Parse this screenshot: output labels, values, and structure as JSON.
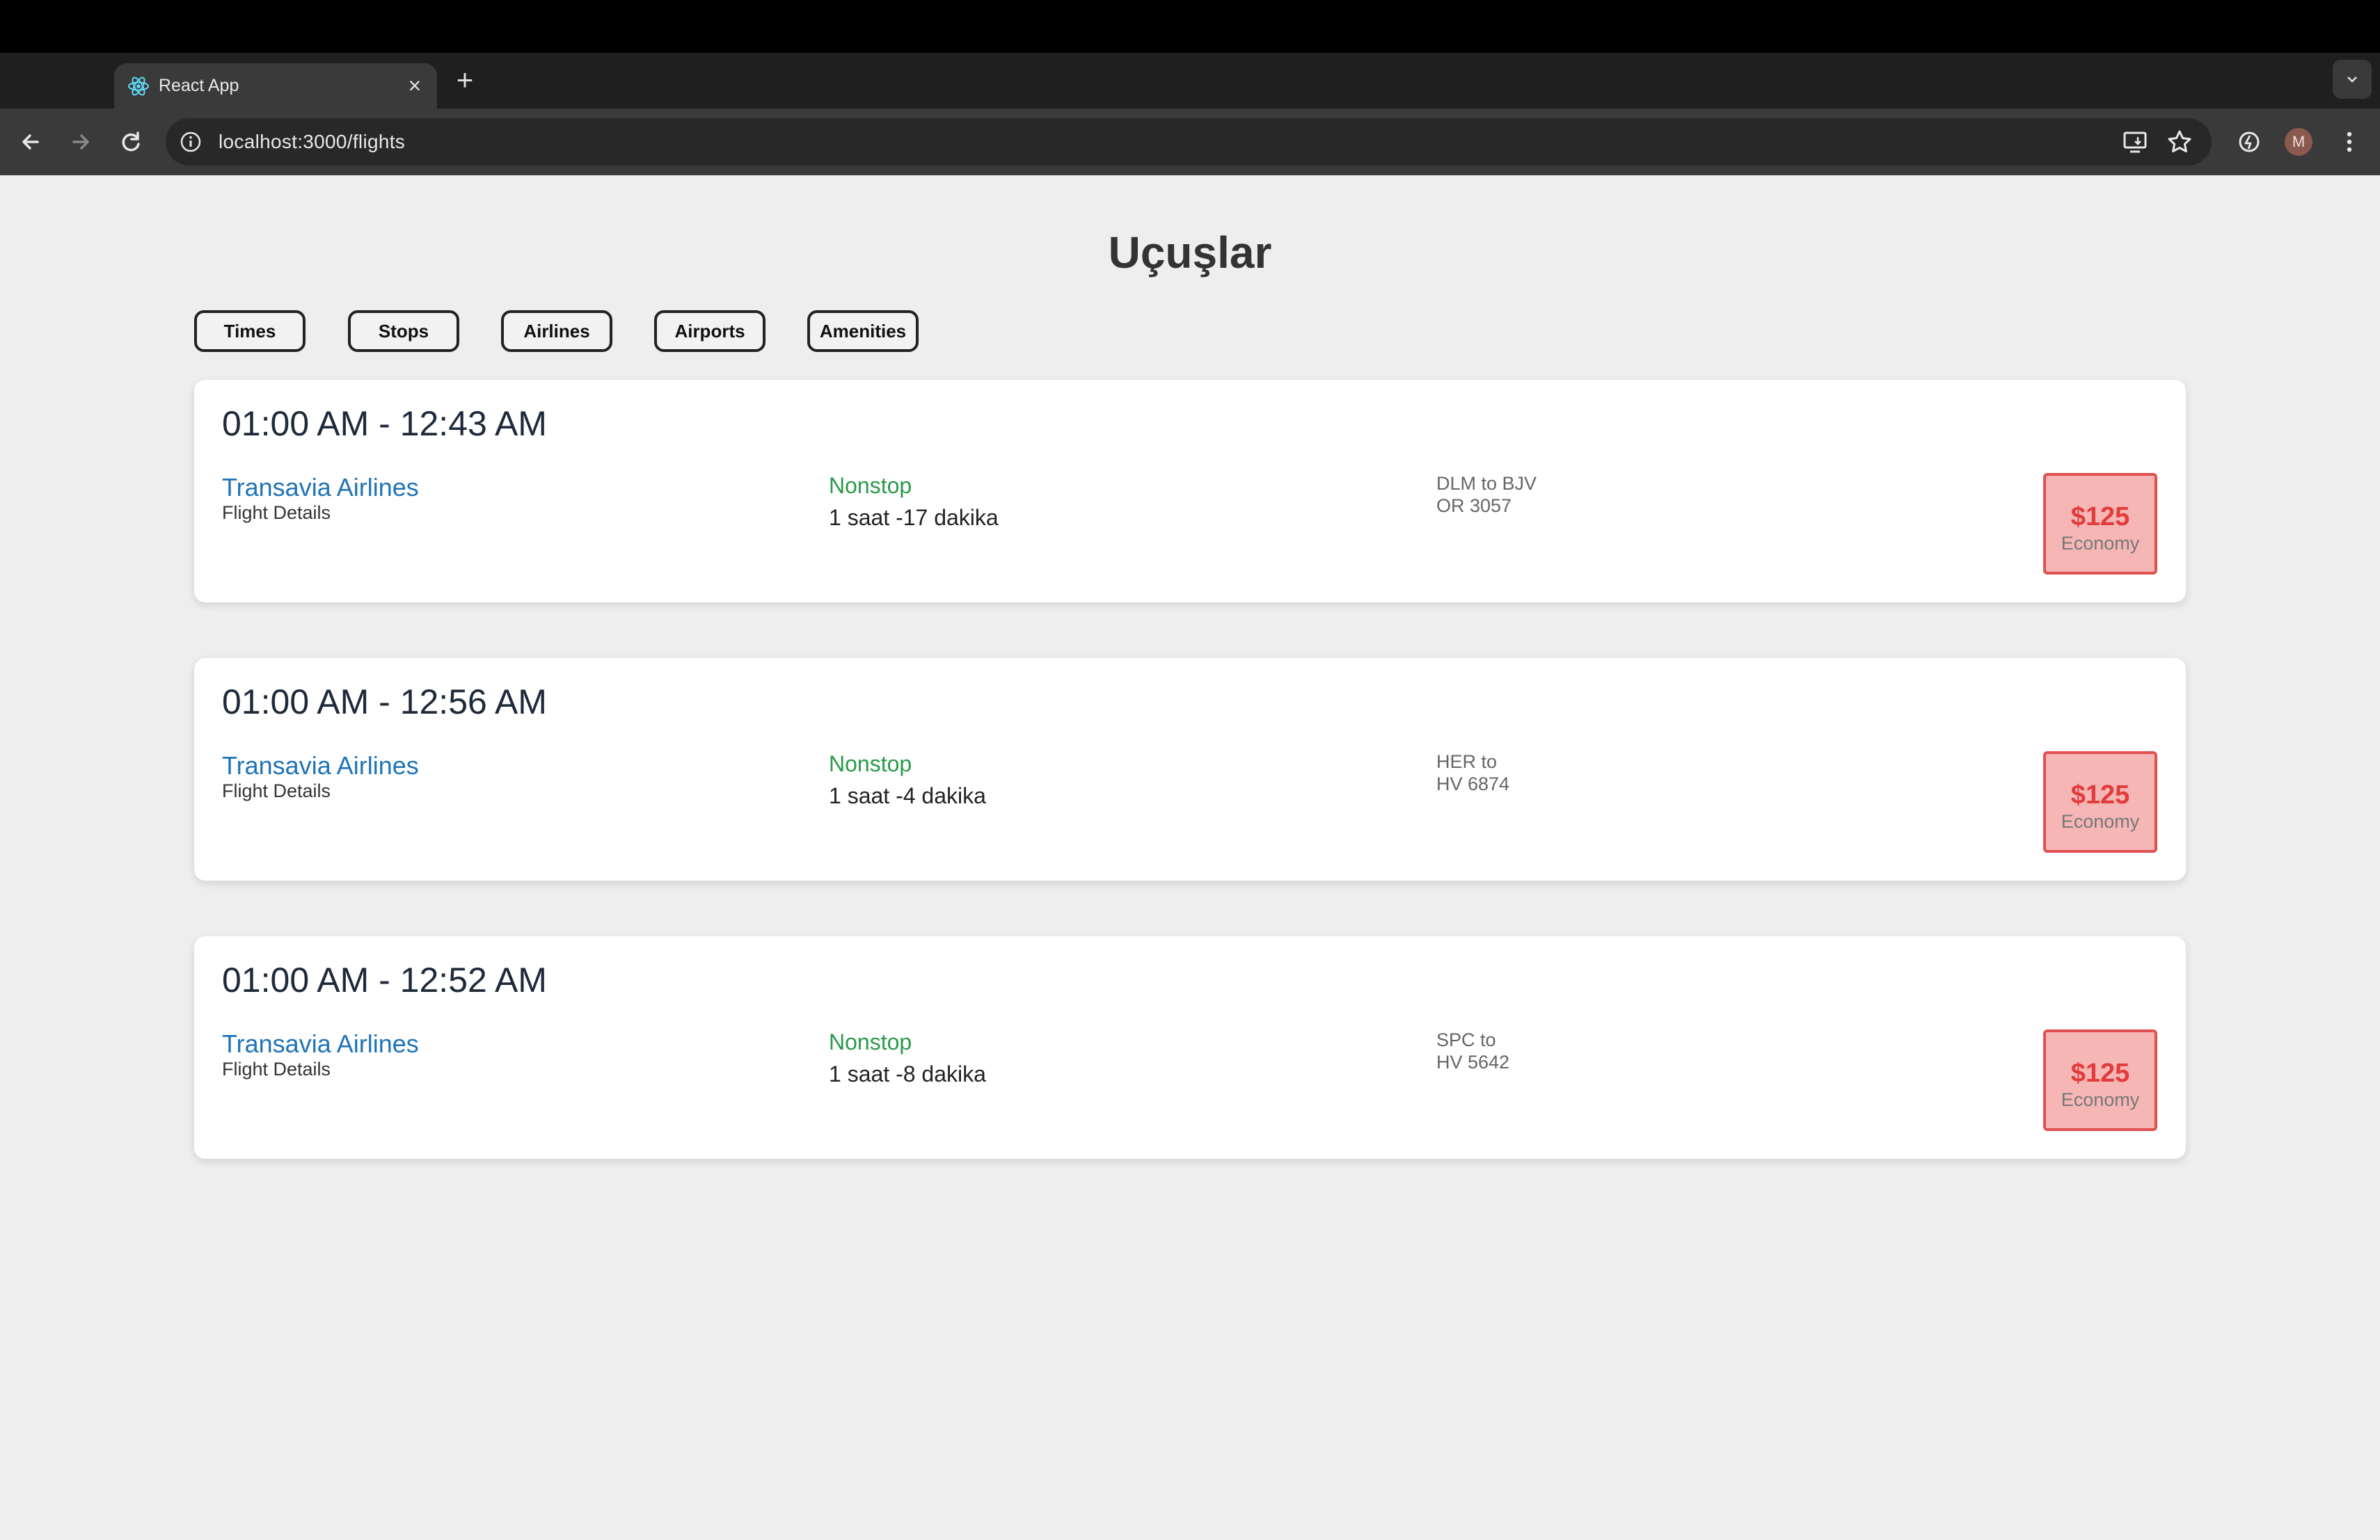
{
  "browser": {
    "tab_title": "React App",
    "url": "localhost:3000/flights",
    "profile_initial": "M"
  },
  "page": {
    "title": "Uçuşlar"
  },
  "filters": [
    "Times",
    "Stops",
    "Airlines",
    "Airports",
    "Amenities"
  ],
  "flights": [
    {
      "time": "01:00 AM - 12:43 AM",
      "airline": "Transavia Airlines",
      "details_label": "Flight Details",
      "stops": "Nonstop",
      "duration": "1 saat -17 dakika",
      "route": "DLM to BJV",
      "flight_no": "OR 3057",
      "price": "$125",
      "cabin": "Economy"
    },
    {
      "time": "01:00 AM - 12:56 AM",
      "airline": "Transavia Airlines",
      "details_label": "Flight Details",
      "stops": "Nonstop",
      "duration": "1 saat -4 dakika",
      "route": "HER to",
      "flight_no": "HV 6874",
      "price": "$125",
      "cabin": "Economy"
    },
    {
      "time": "01:00 AM - 12:52 AM",
      "airline": "Transavia Airlines",
      "details_label": "Flight Details",
      "stops": "Nonstop",
      "duration": "1 saat -8 dakika",
      "route": "SPC to",
      "flight_no": "HV 5642",
      "price": "$125",
      "cabin": "Economy"
    }
  ],
  "colors": {
    "airline": "#1f73b7",
    "nonstop": "#2a9a4a",
    "price": "#e23b3b",
    "price_bg": "#f6b6b6"
  }
}
